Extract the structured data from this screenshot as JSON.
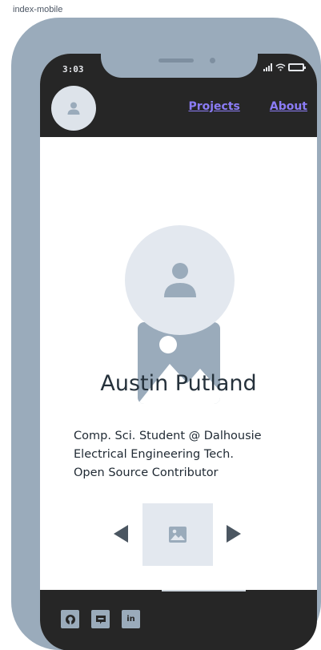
{
  "frame": {
    "label": "index-mobile"
  },
  "status_bar": {
    "time": "3:03"
  },
  "header": {
    "avatar_icon": "user-icon",
    "nav": [
      {
        "label": "Projects"
      },
      {
        "label": "About"
      }
    ]
  },
  "hero": {
    "avatar_icon": "user-icon",
    "image_icon": "image-placeholder-icon",
    "name": "Austin Putland",
    "tagline": [
      "Comp. Sci. Student @ Dalhousie",
      "Electrical Engineering Tech.",
      "Open Source Contributor"
    ]
  },
  "carousel": {
    "prev_icon": "arrow-left-icon",
    "next_icon": "arrow-right-icon",
    "image_icon": "image-icon"
  },
  "footer": {
    "socials": [
      {
        "name": "github-icon",
        "glyph": ""
      },
      {
        "name": "discord-icon",
        "glyph": ""
      },
      {
        "name": "linkedin-icon",
        "glyph": "in"
      }
    ]
  },
  "colors": {
    "frame": "#9aabbb",
    "dark": "#262626",
    "link": "#8b7cf6",
    "placeholder": "#e3e8ef"
  }
}
